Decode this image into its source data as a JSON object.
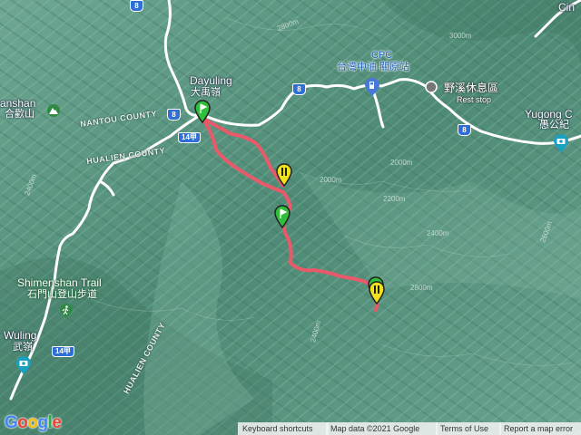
{
  "places": {
    "dayuling_en": "Dayuling",
    "dayuling_cn": "大禹嶺",
    "hehuanshan_en": "anshan",
    "hehuanshan_cn": "合歡山",
    "shimenshan_en": "Shimenshan Trail",
    "shimenshan_cn": "石門山登山步道",
    "wuling_en": "Wuling",
    "wuling_cn": "武嶺",
    "yugong_en": "Yugong C",
    "yugong_cn": "愚公紀",
    "cingjing_partial": "Cin"
  },
  "counties": {
    "nantou": "NANTOU COUNTY",
    "hualien_1": "HUALIEN COUNTY",
    "hualien_2": "HUALIEN COUNTY"
  },
  "pois": {
    "cpc_en": "CPC",
    "cpc_cn": "台灣中油 關原站",
    "rest_cn": "野溪休息區",
    "rest_en": "Rest stop"
  },
  "road_shields": {
    "r8_top": "8",
    "r8_a": "8",
    "r8_b": "8",
    "r8_c": "8",
    "r14a_1": "14甲",
    "r14a_2": "14甲"
  },
  "contours": {
    "c1": "2800m",
    "c2": "2400m",
    "c3": "2000m",
    "c4": "2000m",
    "c5": "2200m",
    "c6": "2400m",
    "c7": "2800m",
    "c8": "3000m",
    "c9": "2600m",
    "c10": "2400m"
  },
  "footer": {
    "keyboard": "Keyboard shortcuts",
    "mapdata": "Map data ©2021 Google",
    "terms": "Terms of Use",
    "report": "Report a map error"
  },
  "logo": "Google",
  "colors": {
    "track": "#e85a6a",
    "terrain": "#5f9a86",
    "marker_green": "#2fbf3a",
    "marker_yellow": "#f2e21c",
    "shield": "#2e6fd6"
  },
  "icons": {
    "start": "map-pin-green-icon",
    "end": "map-pin-yellow-icon",
    "camera": "camera-icon",
    "hiker": "hiking-icon",
    "gas": "gas-station-icon",
    "peak": "mountain-peak-icon"
  }
}
